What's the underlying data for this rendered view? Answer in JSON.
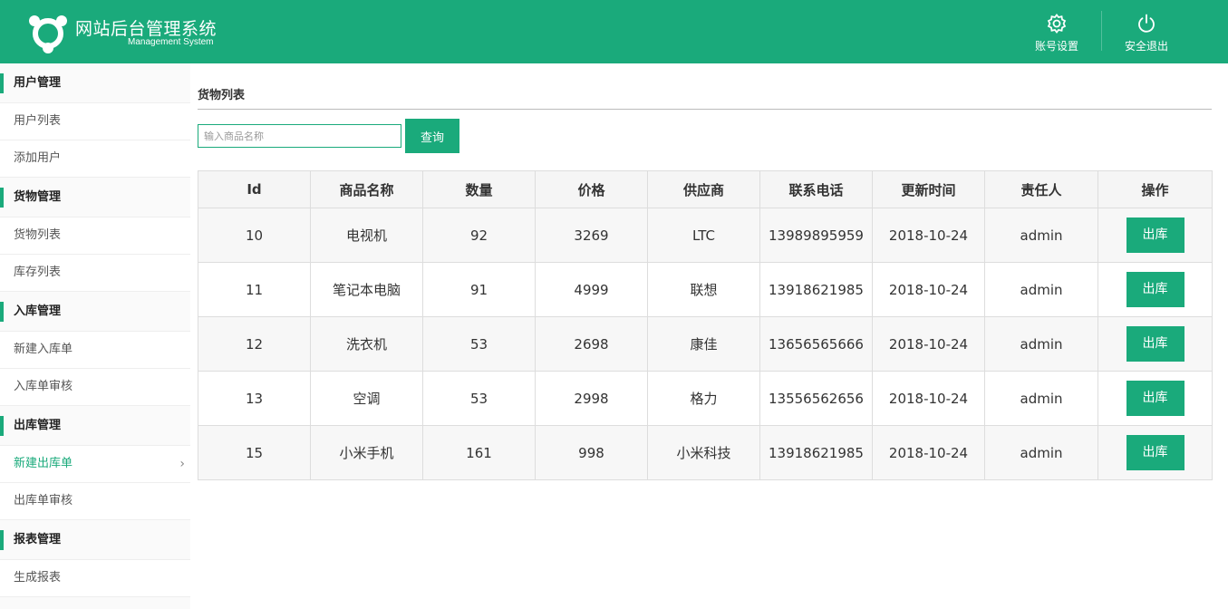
{
  "header": {
    "title": "网站后台管理系统",
    "subtitle": "Management System",
    "account_label": "账号设置",
    "logout_label": "安全退出"
  },
  "sidebar": {
    "groups": [
      {
        "label": "用户管理",
        "items": [
          "用户列表",
          "添加用户"
        ]
      },
      {
        "label": "货物管理",
        "items": [
          "货物列表",
          "库存列表"
        ]
      },
      {
        "label": "入库管理",
        "items": [
          "新建入库单",
          "入库单审核"
        ]
      },
      {
        "label": "出库管理",
        "items": [
          "新建出库单",
          "出库单审核"
        ]
      },
      {
        "label": "报表管理",
        "items": [
          "生成报表"
        ]
      }
    ],
    "active_item": "新建出库单"
  },
  "main": {
    "title": "货物列表",
    "search": {
      "placeholder": "输入商品名称",
      "button_label": "查询"
    },
    "table": {
      "columns": [
        "Id",
        "商品名称",
        "数量",
        "价格",
        "供应商",
        "联系电话",
        "更新时间",
        "责任人",
        "操作"
      ],
      "rows": [
        [
          "10",
          "电视机",
          "92",
          "3269",
          "LTC",
          "13989895959",
          "2018-10-24",
          "admin"
        ],
        [
          "11",
          "笔记本电脑",
          "91",
          "4999",
          "联想",
          "13918621985",
          "2018-10-24",
          "admin"
        ],
        [
          "12",
          "洗衣机",
          "53",
          "2698",
          "康佳",
          "13656565666",
          "2018-10-24",
          "admin"
        ],
        [
          "13",
          "空调",
          "53",
          "2998",
          "格力",
          "13556562656",
          "2018-10-24",
          "admin"
        ],
        [
          "15",
          "小米手机",
          "161",
          "998",
          "小米科技",
          "13918621985",
          "2018-10-24",
          "admin"
        ]
      ],
      "action_label": "出库"
    }
  },
  "colors": {
    "accent": "#1aaa7b"
  },
  "icons": {
    "logo": "logo-icon",
    "account": "gear-icon",
    "logout": "power-icon",
    "active_indicator": "chevron-right-icon"
  }
}
